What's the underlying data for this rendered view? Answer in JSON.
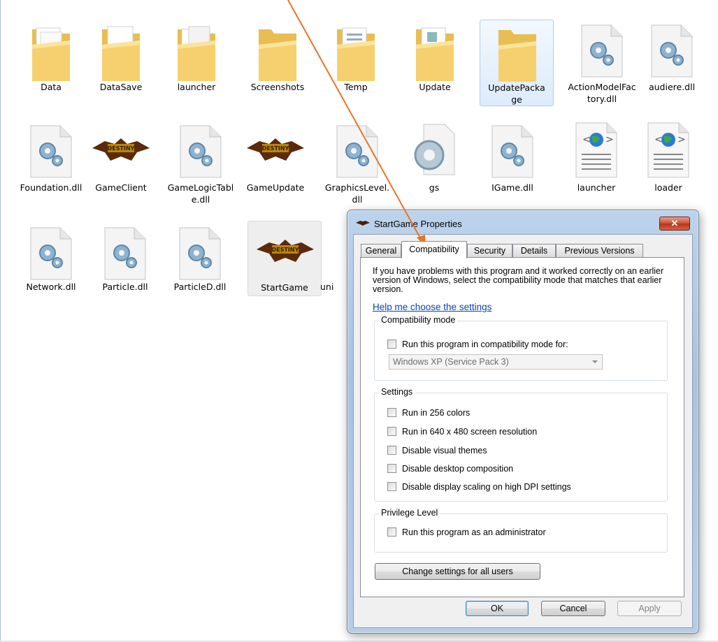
{
  "files": [
    {
      "label": "Data",
      "icon": "folder-icon"
    },
    {
      "label": "DataSave",
      "icon": "folder-icon"
    },
    {
      "label": "launcher",
      "icon": "folder-icon"
    },
    {
      "label": "Screenshots",
      "icon": "folder-icon"
    },
    {
      "label": "Temp",
      "icon": "folder-icon"
    },
    {
      "label": "Update",
      "icon": "folder-icon"
    },
    {
      "label": "UpdatePackage",
      "icon": "folder-icon"
    },
    {
      "label": "ActionModelFactory.dll",
      "icon": "dll-icon"
    },
    {
      "label": "audiere.dll",
      "icon": "dll-icon"
    },
    {
      "label": "Foundation.dll",
      "icon": "dll-icon"
    },
    {
      "label": "GameClient",
      "icon": "destiny-app-icon"
    },
    {
      "label": "GameLogicTable.dll",
      "icon": "dll-icon"
    },
    {
      "label": "GameUpdate",
      "icon": "destiny-app-icon"
    },
    {
      "label": "GraphicsLevel.dll",
      "icon": "dll-icon"
    },
    {
      "label": "gs",
      "icon": "gear-file-icon"
    },
    {
      "label": "IGame.dll",
      "icon": "dll-icon"
    },
    {
      "label": "launcher",
      "icon": "html-file-icon"
    },
    {
      "label": "loader",
      "icon": "html-file-icon"
    },
    {
      "label": "Network.dll",
      "icon": "dll-icon"
    },
    {
      "label": "Particle.dll",
      "icon": "dll-icon"
    },
    {
      "label": "ParticleD.dll",
      "icon": "dll-icon"
    },
    {
      "label": "StartGame",
      "icon": "destiny-app-icon"
    },
    {
      "label": "uni",
      "icon": "dll-icon"
    }
  ],
  "dialog": {
    "title": "StartGame Properties",
    "close_label": "✕",
    "tabs": [
      {
        "label": "General"
      },
      {
        "label": "Compatibility"
      },
      {
        "label": "Security"
      },
      {
        "label": "Details"
      },
      {
        "label": "Previous Versions"
      }
    ],
    "intro_text": "If you have problems with this program and it worked correctly on an earlier version of Windows, select the compatibility mode that matches that earlier version.",
    "help_link": "Help me choose the settings",
    "compat_group": {
      "title": "Compatibility mode",
      "checkbox_label": "Run this program in compatibility mode for:",
      "checked": false,
      "selected_os": "Windows XP (Service Pack 3)"
    },
    "settings_group": {
      "title": "Settings",
      "options": [
        {
          "label": "Run in 256 colors",
          "checked": false
        },
        {
          "label": "Run in 640 x 480 screen resolution",
          "checked": false
        },
        {
          "label": "Disable visual themes",
          "checked": false
        },
        {
          "label": "Disable desktop composition",
          "checked": false
        },
        {
          "label": "Disable display scaling on high DPI settings",
          "checked": false
        }
      ]
    },
    "privilege_group": {
      "title": "Privilege Level",
      "checkbox_label": "Run this program as an administrator",
      "checked": false
    },
    "change_all_button": "Change settings for all users",
    "buttons": {
      "ok": "OK",
      "cancel": "Cancel",
      "apply": "Apply"
    }
  },
  "colors": {
    "annotation_arrow": "#e8742a",
    "folder": "#f6d06f",
    "link": "#0645ad",
    "selection": "#dcebfc"
  }
}
